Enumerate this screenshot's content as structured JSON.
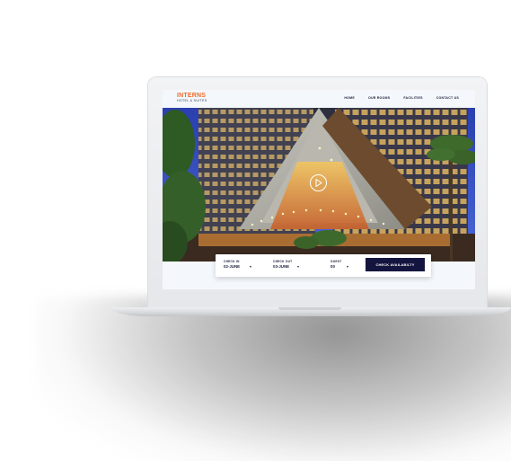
{
  "brand": {
    "name": "INTERNS",
    "tagline": "HOTEL & SUITES",
    "accent_color": "#f06a2a"
  },
  "nav": {
    "items": [
      {
        "label": "HOME"
      },
      {
        "label": "OUR ROOMS"
      },
      {
        "label": "FACILITIES"
      },
      {
        "label": "CONTACT US"
      }
    ]
  },
  "hero": {
    "image": "hotel-building-night-photo",
    "play_icon": "play-icon"
  },
  "booking": {
    "check_in": {
      "label": "CHECK IN",
      "value": "02-JUNE",
      "caret": "chevron-down-icon"
    },
    "check_out": {
      "label": "CHECK OUT",
      "value": "03-JUNE",
      "caret": "chevron-down-icon"
    },
    "guest": {
      "label": "GUEST",
      "value": "00",
      "caret": "chevron-down-icon"
    },
    "cta_label": "CHECK AVAILABILTY",
    "cta_color": "#14153f"
  }
}
